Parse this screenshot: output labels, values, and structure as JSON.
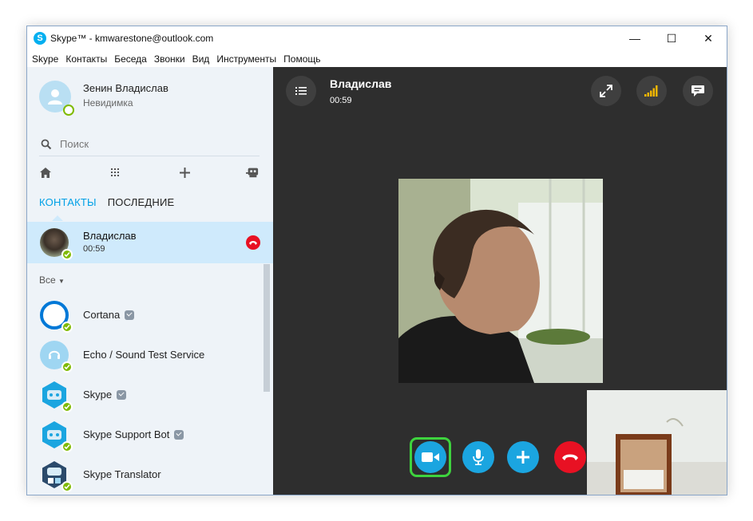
{
  "window": {
    "title": "Skype™ - kmwarestone@outlook.com",
    "logo_letter": "S"
  },
  "window_controls": {
    "minimize": "—",
    "maximize": "☐",
    "close": "✕"
  },
  "menu": [
    "Skype",
    "Контакты",
    "Беседа",
    "Звонки",
    "Вид",
    "Инструменты",
    "Помощь"
  ],
  "profile": {
    "name": "Зенин Владислав",
    "status": "Невидимка"
  },
  "search": {
    "placeholder": "Поиск"
  },
  "tabs": {
    "contacts": "КОНТАКТЫ",
    "recent": "ПОСЛЕДНИЕ"
  },
  "active_call": {
    "name": "Владислав",
    "duration": "00:59"
  },
  "filter": {
    "label": "Все"
  },
  "contacts": [
    {
      "name": "Cortana",
      "verified": true
    },
    {
      "name": "Echo / Sound Test Service",
      "verified": false
    },
    {
      "name": "Skype",
      "verified": true
    },
    {
      "name": "Skype Support Bot",
      "verified": true
    },
    {
      "name": "Skype Translator",
      "verified": false
    }
  ],
  "call": {
    "name": "Владислав",
    "duration": "00:59"
  },
  "colors": {
    "accent": "#00a0e6",
    "skype_blue": "#1ba5e0",
    "hangup": "#e81123",
    "online": "#7fba00",
    "highlight_border": "#3ed33e",
    "call_bg": "#2e2e2e"
  }
}
